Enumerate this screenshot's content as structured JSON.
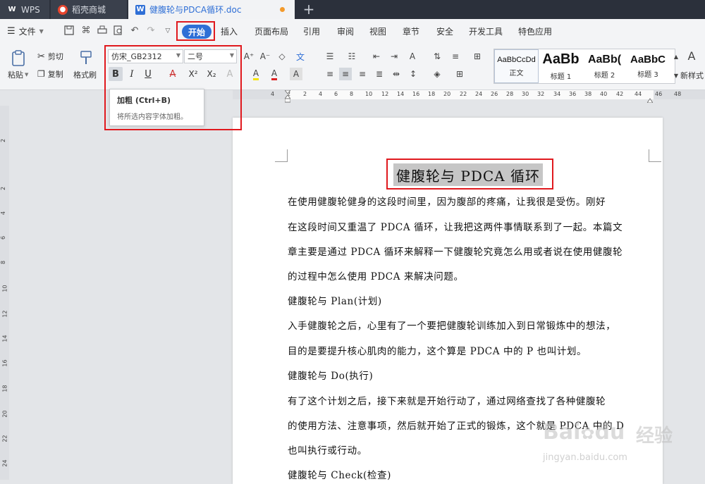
{
  "window_tabs": {
    "app": "WPS",
    "store": "稻壳商城",
    "document": "健腹轮与PDCA循环.doc",
    "add": "+"
  },
  "menubar": {
    "file": "文件",
    "tabs": [
      "开始",
      "插入",
      "页面布局",
      "引用",
      "审阅",
      "视图",
      "章节",
      "安全",
      "开发工具",
      "特色应用"
    ]
  },
  "ribbon": {
    "paste": "粘贴",
    "cut": "剪切",
    "copy": "复制",
    "format_painter": "格式刷",
    "font_name": "仿宋_GB2312",
    "font_size": "二号",
    "styles": [
      {
        "sample": "AaBbCcDd",
        "name": "正文"
      },
      {
        "sample": "AaBb",
        "name": "标题 1"
      },
      {
        "sample": "AaBb(",
        "name": "标题 2"
      },
      {
        "sample": "AaBbC",
        "name": "标题 3"
      }
    ],
    "new_style": "新样式"
  },
  "tooltip": {
    "title": "加粗 (Ctrl+B)",
    "description": "将所选内容字体加粗。"
  },
  "ruler": {
    "ticks": [
      "4",
      "2",
      "2",
      "4",
      "6",
      "8",
      "10",
      "12",
      "14",
      "16",
      "18",
      "20",
      "22",
      "24",
      "26",
      "28",
      "30",
      "32",
      "34",
      "36",
      "38",
      "40",
      "42",
      "44",
      "46",
      "48"
    ],
    "vticks": [
      "2",
      "2",
      "4",
      "6",
      "8",
      "10",
      "12",
      "14",
      "16",
      "18",
      "20",
      "22",
      "24"
    ]
  },
  "document": {
    "title": "健腹轮与 PDCA 循环",
    "lines": [
      "在使用健腹轮健身的这段时间里，因为腹部的疼痛，让我很是受伤。刚好",
      "在这段时间又重温了 PDCA 循环，让我把这两件事情联系到了一起。本篇文",
      "章主要是通过 PDCA 循环来解释一下健腹轮究竟怎么用或者说在使用健腹轮",
      "的过程中怎么使用 PDCA 来解决问题。",
      "健腹轮与 Plan(计划)",
      "入手健腹轮之后，心里有了一个要把健腹轮训练加入到日常锻炼中的想法，",
      "目的是要提升核心肌肉的能力，这个算是 PDCA 中的 P 也叫计划。",
      "健腹轮与 Do(执行)",
      "有了这个计划之后，接下来就是开始行动了，通过网络查找了各种健腹轮",
      "的使用方法、注意事项，然后就开始了正式的锻炼，这个就是 PDCA 中的 D",
      "也叫执行或行动。",
      "健腹轮与 Check(检查)"
    ]
  },
  "watermark": {
    "brand": "Bai",
    "brand2": "du",
    "cn": "经验",
    "url": "jingyan.baidu.com"
  }
}
